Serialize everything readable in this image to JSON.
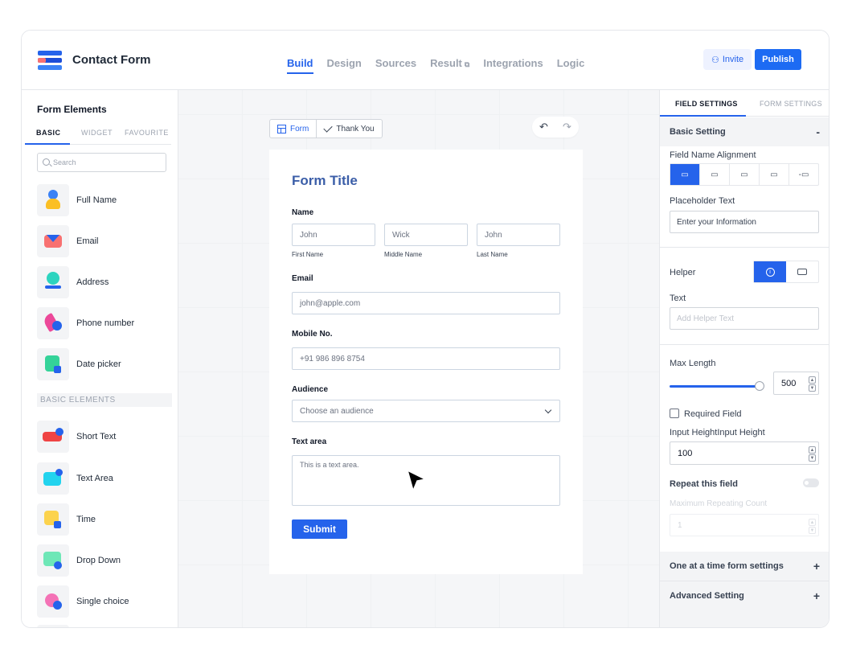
{
  "app": {
    "title": "Contact Form"
  },
  "nav": {
    "tabs": [
      {
        "label": "Build",
        "active": true
      },
      {
        "label": "Design"
      },
      {
        "label": "Sources"
      },
      {
        "label": "Result",
        "external": true
      },
      {
        "label": "Integrations"
      },
      {
        "label": "Logic"
      }
    ],
    "invite_label": "Invite",
    "publish_label": "Publish"
  },
  "left_panel": {
    "title": "Form Elements",
    "tabs": [
      "BASIC",
      "WIDGET",
      "FAVOURITE"
    ],
    "search_placeholder": "Search",
    "basic_items": [
      {
        "label": "Full Name",
        "icon": "person-icon",
        "colors": [
          "#fbbf24",
          "#3b82f6"
        ]
      },
      {
        "label": "Email",
        "icon": "envelope-icon",
        "colors": [
          "#f87171",
          "#2563eb"
        ]
      },
      {
        "label": "Address",
        "icon": "location-icon",
        "colors": [
          "#2dd4bf",
          "#2563eb"
        ]
      },
      {
        "label": "Phone number",
        "icon": "phone-icon",
        "colors": [
          "#ec4899",
          "#2563eb"
        ]
      },
      {
        "label": "Date picker",
        "icon": "calendar-icon",
        "colors": [
          "#34d399",
          "#2563eb"
        ]
      }
    ],
    "section_header": "BASIC ELEMENTS",
    "basic_elements": [
      {
        "label": "Short Text",
        "icon": "short-text-icon",
        "colors": [
          "#ef4444",
          "#2563eb"
        ]
      },
      {
        "label": "Text Area",
        "icon": "text-area-icon",
        "colors": [
          "#22d3ee",
          "#2563eb"
        ]
      },
      {
        "label": "Time",
        "icon": "clock-icon",
        "colors": [
          "#fcd34d",
          "#2563eb"
        ]
      },
      {
        "label": "Drop Down",
        "icon": "dropdown-icon",
        "colors": [
          "#6ee7b7",
          "#2563eb"
        ]
      },
      {
        "label": "Single choice",
        "icon": "radio-icon",
        "colors": [
          "#f472b6",
          "#2563eb"
        ]
      }
    ]
  },
  "canvas": {
    "segment": {
      "form_label": "Form",
      "thank_you_label": "Thank You"
    },
    "undo_symbol": "↶",
    "redo_symbol": "↷",
    "form": {
      "title": "Form Title",
      "name_label": "Name",
      "first_name_value": "John",
      "middle_name_value": "Wick",
      "last_name_value": "John",
      "first_name_caption": "First Name",
      "middle_name_caption": "Middle Name",
      "last_name_caption": "Last Name",
      "email_label": "Email",
      "email_value": "john@apple.com",
      "mobile_label": "Mobile No.",
      "mobile_value": "+91 986 896 8754",
      "audience_label": "Audience",
      "audience_value": "Choose an audience",
      "textarea_label": "Text area",
      "textarea_value": "This is a text area.",
      "submit_label": "Submit"
    }
  },
  "right_panel": {
    "tabs": [
      "FIELD SETTINGS",
      "FORM SETTINGS"
    ],
    "basic_setting": {
      "title": "Basic Setting",
      "toggle": "-"
    },
    "field_name_alignment_label": "Field Name Alignment",
    "alignment_options": [
      "align-top-icon",
      "align-left-icon",
      "align-bottom-icon",
      "align-inline-icon",
      "align-hidden-icon"
    ],
    "placeholder_text_label": "Placeholder Text",
    "placeholder_text_value": "Enter your Information",
    "helper_label": "Helper",
    "text_label": "Text",
    "helper_text_placeholder": "Add Helper Text",
    "max_length_label": "Max Length",
    "max_length_value": "500",
    "max_length_fraction": 0.95,
    "required_field_label": "Required Field",
    "input_height_label": "Input HeightInput Height",
    "input_height_value": "100",
    "repeat_field_label": "Repeat this field",
    "max_repeating_label": "Maximum Repeating Count",
    "max_repeating_value": "1",
    "one_at_a_time": {
      "title": "One at a time form settings",
      "toggle": "+"
    },
    "advanced": {
      "title": "Advanced Setting",
      "toggle": "+"
    }
  },
  "colors": {
    "accent": "#2563eb",
    "title_blue": "#3b5ea8",
    "canvas_bg": "#f5f6f8"
  }
}
